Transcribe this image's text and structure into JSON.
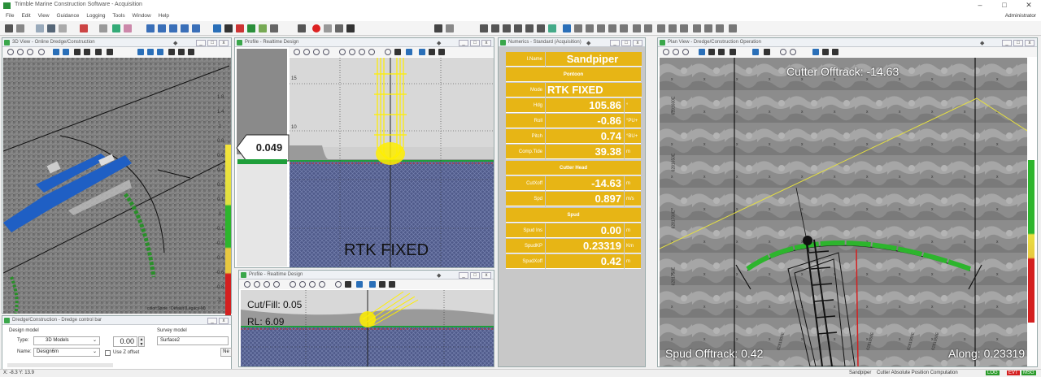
{
  "app": {
    "title": "Trimble Marine Construction Software - Acquisition",
    "user": "Administrator",
    "menu": [
      "File",
      "Edit",
      "View",
      "Guidance",
      "Logging",
      "Tools",
      "Window",
      "Help"
    ]
  },
  "view3d": {
    "title": "3D View - Online Dredge/Construction",
    "scale": [
      "1.8",
      "1.4",
      "1",
      "0.8",
      "0.6",
      "0.4",
      "0.2",
      "0.1",
      "0",
      "-0.1",
      "-0.2",
      "-0.4",
      "-0.6",
      "-0.8",
      "-1",
      "-1.4",
      "-1.8"
    ],
    "footer": "color:Spine : Default (Legacy-M)"
  },
  "profile1": {
    "title": "Profile - Realtime Design",
    "depth_value": "0.049",
    "status": "RTK FIXED",
    "ticks": [
      "15",
      "10"
    ]
  },
  "profile2": {
    "title": "Profile - Realtime Design",
    "cutfill": "Cut/Fill: 0.05",
    "rl": "RL: 6.09"
  },
  "numerics": {
    "title": "Numerics - Standard (Acquisition)",
    "rows": [
      {
        "label": "I.Name",
        "value": "Sandpiper",
        "unit": ""
      },
      {
        "header": "Pontoon"
      },
      {
        "label": "Mode",
        "value": "RTK FIXED",
        "unit": ""
      },
      {
        "label": "Hdg",
        "value": "105.86",
        "unit": "°"
      },
      {
        "label": "Roll",
        "value": "-0.86",
        "unit": "°PU+"
      },
      {
        "label": "Pitch",
        "value": "0.74",
        "unit": "°BU+"
      },
      {
        "label": "Comp.Tide",
        "value": "39.38",
        "unit": "m"
      },
      {
        "header": "Cutter Head"
      },
      {
        "label": "CutXoff",
        "value": "-14.63",
        "unit": "m"
      },
      {
        "label": "Spd",
        "value": "0.897",
        "unit": "m/s"
      },
      {
        "header": "Spud"
      },
      {
        "label": "Spud Ins",
        "value": "0.00",
        "unit": "m"
      },
      {
        "label": "SpudKP",
        "value": "0.23319",
        "unit": "Km"
      },
      {
        "label": "SpudXoff",
        "value": "0.42",
        "unit": "m"
      }
    ]
  },
  "planview": {
    "title": "Plan View - Dredge/Construction Operation",
    "cutter_offtrack": "Cutter Offtrack: -14.63",
    "spud_offtrack": "Spud Offtrack: 0.42",
    "along": "Along: 0.23319",
    "grid_labels": [
      "6281600E",
      "6281650E",
      "6281700E",
      "6281750E",
      "6281800E",
      "6281850E",
      "6281900E",
      "6281950E"
    ]
  },
  "controlbar": {
    "title": "Dredge/Construction - Dredge control bar",
    "design_model_label": "Design model",
    "type_label": "Type:",
    "type_value": "3D Models",
    "name_label": "Name:",
    "name_value": "Design6m",
    "offset_value": "0.00",
    "use_z_label": "Use Z offset",
    "survey_model_label": "Survey model",
    "survey_value": "Surface2",
    "ne_label": "Ne"
  },
  "statusbar": {
    "coords": "X: -8.3  Y: 13.9",
    "vessel": "Sandpiper",
    "computation": "Cutter Absolute Position Computation",
    "badges": [
      "LOG",
      "EVT",
      "MSG"
    ]
  },
  "colors": {
    "accent_yellow": "#e7b515",
    "green": "#2db52d",
    "blue": "#1f5fc4",
    "red": "#d42020"
  }
}
